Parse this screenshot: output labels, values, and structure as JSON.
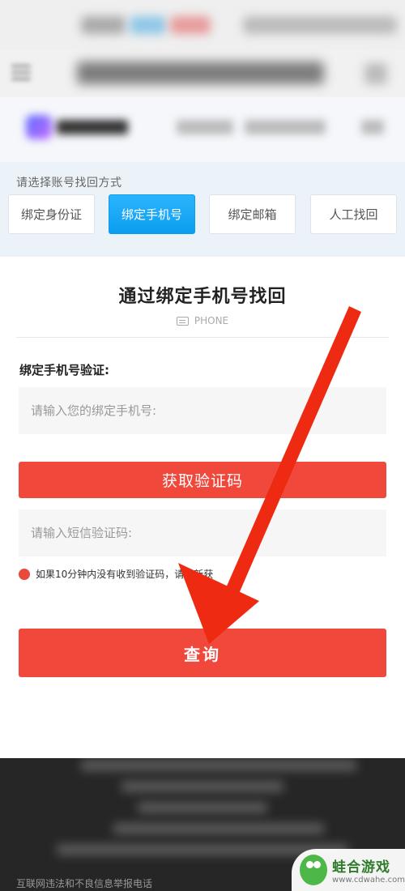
{
  "method_section": {
    "title": "请选择账号找回方式",
    "tabs": [
      {
        "label": "绑定身份证",
        "active": false
      },
      {
        "label": "绑定手机号",
        "active": true
      },
      {
        "label": "绑定邮箱",
        "active": false
      },
      {
        "label": "人工找回",
        "active": false
      }
    ]
  },
  "form": {
    "title": "通过绑定手机号找回",
    "subtitle": "PHONE",
    "field_label": "绑定手机号验证:",
    "phone_placeholder": "请输入您的绑定手机号:",
    "get_code_label": "获取验证码",
    "code_placeholder": "请输入短信验证码:",
    "notice": "如果10分钟内没有收到验证码，请重新获",
    "query_label": "查询"
  },
  "footer": {
    "text": "互联网违法和不良信息举报电话"
  },
  "watermark": {
    "name": "蛙合游戏",
    "url": "www.cdwahe.com"
  },
  "colors": {
    "accent_blue": "#0c9df0",
    "accent_red": "#f0493c",
    "arrow_red": "#ee2a12"
  },
  "icons": {
    "subtitle_icon": "phone-card-icon",
    "notice_icon": "red-dot-icon",
    "overlay": "red-arrow-annotation"
  }
}
